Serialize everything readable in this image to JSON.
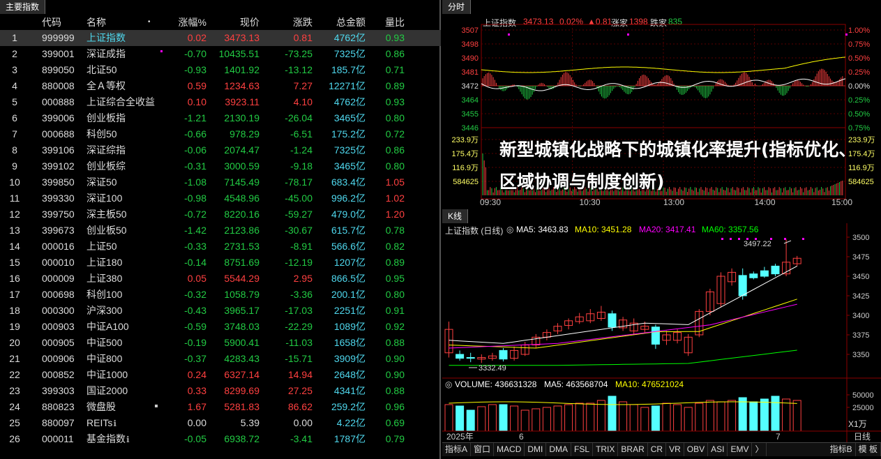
{
  "left_tab": "主要指数",
  "headers": {
    "code": "代码",
    "name": "名称",
    "pct": "涨幅%",
    "price": "现价",
    "chg": "涨跌",
    "amt": "总金额",
    "ratio": "量比"
  },
  "rows": [
    {
      "i": "1",
      "code": "999999",
      "name": "上证指数",
      "pct": "0.02",
      "price": "3473.13",
      "chg": "0.81",
      "amt": "4762亿",
      "ratio": "0.93",
      "pc": "red",
      "rc": "green"
    },
    {
      "i": "2",
      "code": "399001",
      "name": "深证成指",
      "pct": "-0.70",
      "price": "10435.51",
      "chg": "-73.25",
      "amt": "7325亿",
      "ratio": "0.86",
      "pc": "green",
      "rc": "green"
    },
    {
      "i": "3",
      "code": "899050",
      "name": "北证50",
      "pct": "-0.93",
      "price": "1401.92",
      "chg": "-13.12",
      "amt": "185.7亿",
      "ratio": "0.71",
      "pc": "green",
      "rc": "green"
    },
    {
      "i": "4",
      "code": "880008",
      "name": "全Ａ等权",
      "pct": "0.59",
      "price": "1234.63",
      "chg": "7.27",
      "amt": "12271亿",
      "ratio": "0.89",
      "pc": "red",
      "rc": "green"
    },
    {
      "i": "5",
      "code": "000888",
      "name": "上证综合全收益",
      "pct": "0.10",
      "price": "3923.11",
      "chg": "4.10",
      "amt": "4762亿",
      "ratio": "0.93",
      "pc": "red",
      "rc": "green"
    },
    {
      "i": "6",
      "code": "399006",
      "name": "创业板指",
      "pct": "-1.21",
      "price": "2130.19",
      "chg": "-26.04",
      "amt": "3465亿",
      "ratio": "0.80",
      "pc": "green",
      "rc": "green"
    },
    {
      "i": "7",
      "code": "000688",
      "name": "科创50",
      "pct": "-0.66",
      "price": "978.29",
      "chg": "-6.51",
      "amt": "175.2亿",
      "ratio": "0.72",
      "pc": "green",
      "rc": "green"
    },
    {
      "i": "8",
      "code": "399106",
      "name": "深证综指",
      "pct": "-0.06",
      "price": "2074.47",
      "chg": "-1.24",
      "amt": "7325亿",
      "ratio": "0.86",
      "pc": "green",
      "rc": "green"
    },
    {
      "i": "9",
      "code": "399102",
      "name": "创业板综",
      "pct": "-0.31",
      "price": "3000.59",
      "chg": "-9.18",
      "amt": "3465亿",
      "ratio": "0.80",
      "pc": "green",
      "rc": "green"
    },
    {
      "i": "10",
      "code": "399850",
      "name": "深证50",
      "pct": "-1.08",
      "price": "7145.49",
      "chg": "-78.17",
      "amt": "683.4亿",
      "ratio": "1.05",
      "pc": "green",
      "rc": "red"
    },
    {
      "i": "11",
      "code": "399330",
      "name": "深证100",
      "pct": "-0.98",
      "price": "4548.96",
      "chg": "-45.00",
      "amt": "996.2亿",
      "ratio": "1.02",
      "pc": "green",
      "rc": "red"
    },
    {
      "i": "12",
      "code": "399750",
      "name": "深主板50",
      "pct": "-0.72",
      "price": "8220.16",
      "chg": "-59.27",
      "amt": "479.0亿",
      "ratio": "1.20",
      "pc": "green",
      "rc": "red"
    },
    {
      "i": "13",
      "code": "399673",
      "name": "创业板50",
      "pct": "-1.42",
      "price": "2123.86",
      "chg": "-30.67",
      "amt": "615.7亿",
      "ratio": "0.78",
      "pc": "green",
      "rc": "green"
    },
    {
      "i": "14",
      "code": "000016",
      "name": "上证50",
      "pct": "-0.33",
      "price": "2731.53",
      "chg": "-8.91",
      "amt": "566.6亿",
      "ratio": "0.82",
      "pc": "green",
      "rc": "green"
    },
    {
      "i": "15",
      "code": "000010",
      "name": "上证180",
      "pct": "-0.14",
      "price": "8751.69",
      "chg": "-12.19",
      "amt": "1207亿",
      "ratio": "0.89",
      "pc": "green",
      "rc": "green"
    },
    {
      "i": "16",
      "code": "000009",
      "name": "上证380",
      "pct": "0.05",
      "price": "5544.29",
      "chg": "2.95",
      "amt": "866.5亿",
      "ratio": "0.95",
      "pc": "red",
      "rc": "green"
    },
    {
      "i": "17",
      "code": "000698",
      "name": "科创100",
      "pct": "-0.32",
      "price": "1058.79",
      "chg": "-3.36",
      "amt": "200.1亿",
      "ratio": "0.80",
      "pc": "green",
      "rc": "green"
    },
    {
      "i": "18",
      "code": "000300",
      "name": "沪深300",
      "pct": "-0.43",
      "price": "3965.17",
      "chg": "-17.03",
      "amt": "2251亿",
      "ratio": "0.91",
      "pc": "green",
      "rc": "green"
    },
    {
      "i": "19",
      "code": "000903",
      "name": "中证A100",
      "pct": "-0.59",
      "price": "3748.03",
      "chg": "-22.29",
      "amt": "1089亿",
      "ratio": "0.92",
      "pc": "green",
      "rc": "green"
    },
    {
      "i": "20",
      "code": "000905",
      "name": "中证500",
      "pct": "-0.19",
      "price": "5900.41",
      "chg": "-11.03",
      "amt": "1658亿",
      "ratio": "0.88",
      "pc": "green",
      "rc": "green"
    },
    {
      "i": "21",
      "code": "000906",
      "name": "中证800",
      "pct": "-0.37",
      "price": "4283.43",
      "chg": "-15.71",
      "amt": "3909亿",
      "ratio": "0.90",
      "pc": "green",
      "rc": "green"
    },
    {
      "i": "22",
      "code": "000852",
      "name": "中证1000",
      "pct": "0.24",
      "price": "6327.14",
      "chg": "14.94",
      "amt": "2648亿",
      "ratio": "0.90",
      "pc": "red",
      "rc": "green"
    },
    {
      "i": "23",
      "code": "399303",
      "name": "国证2000",
      "pct": "0.33",
      "price": "8299.69",
      "chg": "27.25",
      "amt": "4341亿",
      "ratio": "0.88",
      "pc": "red",
      "rc": "green"
    },
    {
      "i": "24",
      "code": "880823",
      "name": "微盘股",
      "pct": "1.67",
      "price": "5281.83",
      "chg": "86.62",
      "amt": "259.2亿",
      "ratio": "0.96",
      "pc": "red",
      "rc": "green"
    },
    {
      "i": "25",
      "code": "880097",
      "name": "REITs",
      "pct": "0.00",
      "price": "5.39",
      "chg": "0.00",
      "amt": "4.22亿",
      "ratio": "0.69",
      "pc": "white",
      "rc": "green"
    },
    {
      "i": "26",
      "code": "000011",
      "name": "基金指数",
      "pct": "-0.05",
      "price": "6938.72",
      "chg": "-3.41",
      "amt": "1787亿",
      "ratio": "0.79",
      "pc": "green",
      "rc": "green"
    }
  ],
  "minute": {
    "tab": "分时",
    "title": "上证指数",
    "price": "3473.13",
    "pct": "0.02%",
    "chg": "▲0.81",
    "up_label": "涨家",
    "up": "1398",
    "down_label": "跌家",
    "down": "835",
    "left_axis": [
      "3507",
      "3498",
      "3490",
      "3481",
      "3472",
      "3464",
      "3455",
      "3446"
    ],
    "right_axis": [
      "1.00%",
      "0.75%",
      "0.50%",
      "0.25%",
      "0.00%",
      "0.25%",
      "0.50%",
      "0.75%"
    ],
    "vol_left": [
      "233.9万",
      "175.4万",
      "116.9万",
      "584625"
    ],
    "vol_right": [
      "233.9万",
      "175.4万",
      "116.9万",
      "584625"
    ],
    "times": [
      "09:30",
      "10:30",
      "13:00",
      "14:00",
      "15:00"
    ]
  },
  "overlay_text": "新型城镇化战略下的城镇化率提升(指标优化、区域协调与制度创新)",
  "kline": {
    "tab": "K线",
    "title": "上证指数 (日线)",
    "ma5": "MA5: 3463.83",
    "ma10": "MA10: 3451.28",
    "ma20": "MA20: 3417.41",
    "ma60": "MA60: 3357.56",
    "high_label": "3497.22",
    "low_label": "3332.49",
    "axis": [
      "3500",
      "3475",
      "3450",
      "3425",
      "3400",
      "3375",
      "3350"
    ],
    "vol_title": "VOLUME: 436631328",
    "vol_ma5": "MA5: 463568704",
    "vol_ma10": "MA10: 476521024",
    "vol_axis": [
      "50000",
      "25000"
    ],
    "vol_unit": "X1万",
    "date_left": "2025年",
    "date_mid": "6",
    "date_right": "7",
    "period": "日线"
  },
  "indicators": [
    "指标A",
    "窗口",
    "MACD",
    "DMI",
    "DMA",
    "FSL",
    "TRIX",
    "BRAR",
    "CR",
    "VR",
    "OBV",
    "ASI",
    "EMV"
  ],
  "ind_more": "〉",
  "ind_right": [
    "指标B",
    "模 板"
  ],
  "colors": {
    "up": "#ff4040",
    "down": "#22cc44",
    "amount": "#4fd8ee",
    "ma5": "#ffffff",
    "ma10": "#ffff00",
    "ma20": "#ff00ff",
    "ma60": "#00ff00"
  },
  "chart_data": [
    {
      "type": "line",
      "title": "上证指数 分时",
      "x": [
        "09:30",
        "10:30",
        "13:00",
        "14:00",
        "15:00"
      ],
      "series": [
        {
          "name": "上证指数",
          "values": [
            3470,
            3466,
            3469,
            3471,
            3473.13
          ]
        }
      ],
      "ylim": [
        3446,
        3507
      ]
    },
    {
      "type": "bar",
      "title": "上证指数 (日线)",
      "categories": [
        "2025年",
        "6",
        "7"
      ],
      "series": [
        {
          "name": "MA5",
          "values": [
            3463.83
          ]
        },
        {
          "name": "MA10",
          "values": [
            3451.28
          ]
        },
        {
          "name": "MA20",
          "values": [
            3417.41
          ]
        },
        {
          "name": "MA60",
          "values": [
            3357.56
          ]
        }
      ],
      "ylim": [
        3330,
        3505
      ]
    }
  ]
}
